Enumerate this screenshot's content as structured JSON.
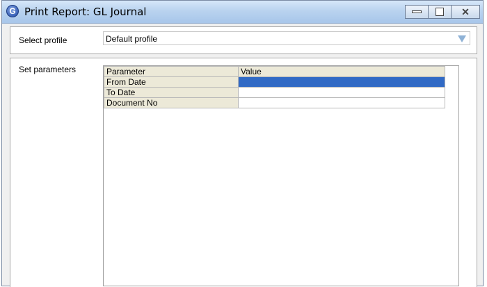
{
  "window": {
    "title": "Print Report: GL Journal",
    "icon": "app-g-icon",
    "icon_glyph": "G",
    "controls": [
      "minimize-icon",
      "maximize-icon",
      "close-icon"
    ]
  },
  "profile": {
    "label": "Select profile",
    "selected": "Default profile"
  },
  "parameters": {
    "label": "Set parameters",
    "columns": [
      "Parameter",
      "Value"
    ],
    "rows": [
      {
        "name": "From Date",
        "value": ""
      },
      {
        "name": "To Date",
        "value": ""
      },
      {
        "name": "Document No",
        "value": ""
      }
    ],
    "selected_row": 0
  },
  "colors": {
    "selection": "#316ac5",
    "header_bg": "#ece9d8"
  }
}
